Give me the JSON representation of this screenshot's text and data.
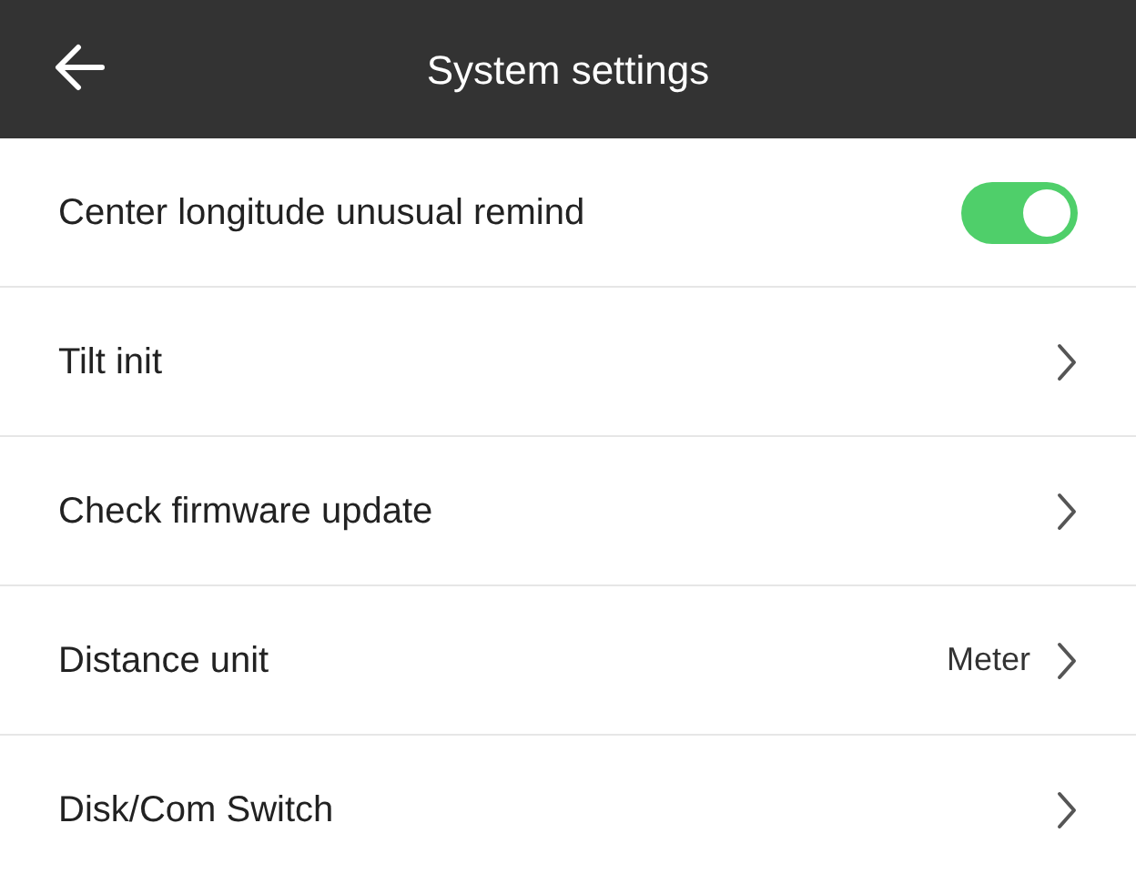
{
  "header": {
    "title": "System settings"
  },
  "rows": [
    {
      "kind": "toggle",
      "label": "Center longitude unusual remind",
      "on": true
    },
    {
      "kind": "link",
      "label": "Tilt init"
    },
    {
      "kind": "link",
      "label": "Check firmware update"
    },
    {
      "kind": "value",
      "label": "Distance unit",
      "value": "Meter"
    },
    {
      "kind": "link",
      "label": "Disk/Com Switch"
    }
  ]
}
